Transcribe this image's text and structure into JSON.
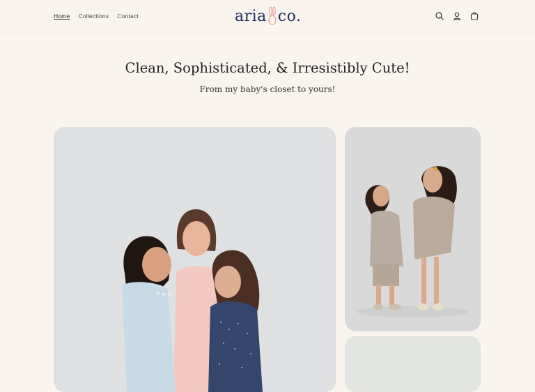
{
  "nav": {
    "items": [
      {
        "label": "Home",
        "active": true
      },
      {
        "label": "Collections",
        "active": false
      },
      {
        "label": "Contact",
        "active": false
      }
    ]
  },
  "logo": {
    "part1": "aria",
    "part2": "co."
  },
  "header_icons": [
    "search-icon",
    "account-icon",
    "cart-icon"
  ],
  "hero": {
    "title": "Clean, Sophisticated, & Irresistibly Cute!",
    "subtitle": "From my baby's closet to yours!"
  },
  "colors": {
    "background": "#faf4ef",
    "logo": "#23305f",
    "bunny": "#e89aa0"
  }
}
